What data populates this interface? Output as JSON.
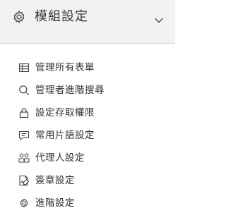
{
  "header": {
    "title": "模組設定",
    "icon": "gear-icon",
    "toggle_icon": "chevron-down-icon",
    "background": "#f2f2f2"
  },
  "menu": {
    "items": [
      {
        "label": "管理所有表單",
        "icon": "table-icon"
      },
      {
        "label": "管理者進階搜尋",
        "icon": "search-icon"
      },
      {
        "label": "設定存取權限",
        "icon": "lock-icon"
      },
      {
        "label": "常用片語設定",
        "icon": "message-icon"
      },
      {
        "label": "代理人設定",
        "icon": "users-icon"
      },
      {
        "label": "簽章設定",
        "icon": "signature-icon"
      },
      {
        "label": "進階設定",
        "icon": "gear-icon"
      }
    ]
  },
  "colors": {
    "text": "#333333",
    "icon": "#444444",
    "divider": "#d6d6d6"
  }
}
